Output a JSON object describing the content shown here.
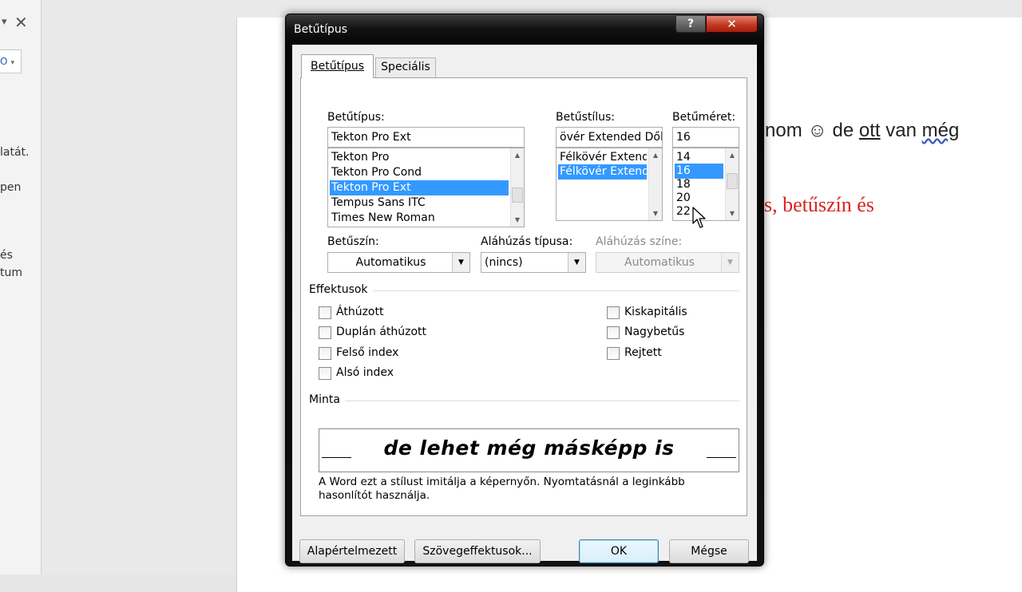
{
  "background": {
    "left_pane": {
      "dropdown_arrow": "▾",
      "close_glyph": "✕",
      "box_value": "O",
      "snippets": [
        "latát.",
        "pen",
        "és",
        "tum"
      ]
    },
    "document": {
      "line1": {
        "pre": "nom ☺ de ",
        "underlined": "ott",
        "mid": " van ",
        "wavy": "még"
      },
      "line2": "s, betűszín és"
    }
  },
  "dialog": {
    "title": "Betűtípus",
    "help_label": "?",
    "close_label": "✕",
    "tabs": [
      {
        "label": "Betűtípus",
        "active": true
      },
      {
        "label": "Speciális",
        "active": false
      }
    ],
    "font": {
      "label": "Betűtípus:",
      "value": "Tekton Pro Ext",
      "items": [
        "Tekton Pro",
        "Tekton Pro Cond",
        "Tekton Pro Ext",
        "Tempus Sans ITC",
        "Times New Roman"
      ],
      "selected_index": 2
    },
    "style": {
      "label": "Betűstílus:",
      "value": "övér Extended Dőlt",
      "items": [
        "Félkövér Extended",
        "Félkövér Extended Dőlt"
      ],
      "selected_index": 1
    },
    "size": {
      "label": "Betűméret:",
      "value": "16",
      "items": [
        "14",
        "16",
        "18",
        "20",
        "22"
      ],
      "selected_index": 1
    },
    "color": {
      "label": "Betűszín:",
      "value": "Automatikus"
    },
    "underline_type": {
      "label": "Aláhúzás típusa:",
      "value": "(nincs)"
    },
    "underline_color": {
      "label": "Aláhúzás színe:",
      "value": "Automatikus"
    },
    "effects": {
      "title": "Effektusok",
      "left": [
        "Áthúzott",
        "Duplán áthúzott",
        "Felső index",
        "Alsó index"
      ],
      "right": [
        "Kiskapitális",
        "Nagybetűs",
        "Rejtett"
      ]
    },
    "preview": {
      "title": "Minta",
      "text": "de lehet még másképp is",
      "note": "A Word ezt a stílust imitálja a képernyőn. Nyomtatásnál a leginkább hasonlítót használja."
    },
    "buttons": {
      "default": "Alapértelmezett",
      "text_effects": "Szövegeffektusok...",
      "ok": "OK",
      "cancel": "Mégse"
    }
  },
  "colors": {
    "selection": "#3399ff",
    "doc_red_text": "#d8231f",
    "close_button": "#c23a22"
  }
}
